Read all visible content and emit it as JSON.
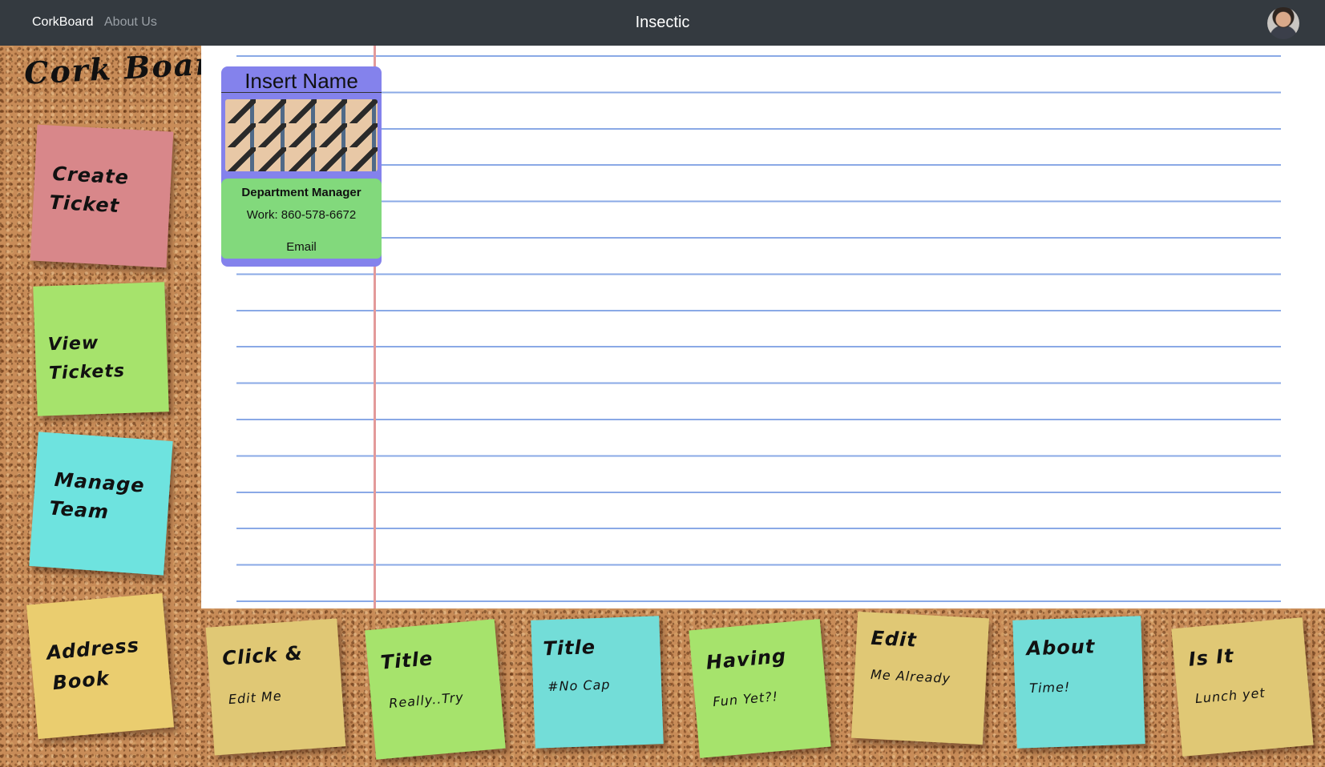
{
  "navbar": {
    "brand": "CorkBoard",
    "about": "About Us",
    "title": "Insectic",
    "avatar_icon": "user-avatar"
  },
  "sidebar": {
    "title": "Cork Board",
    "notes": [
      {
        "line1": "Create",
        "line2": "Ticket",
        "color": "#d8878a"
      },
      {
        "line1": "View Tickets",
        "line2": "",
        "color": "#a6e36c"
      },
      {
        "line1": "Manage",
        "line2": "Team",
        "color": "#6ee3df"
      },
      {
        "line1": "Address",
        "line2": "Book",
        "color": "#eacd6f"
      }
    ]
  },
  "card": {
    "name": "Insert Name",
    "role": "Department Manager",
    "phone": "Work: 860-578-6672",
    "email": "Email",
    "header_color": "#8482ec",
    "body_color": "#82d97c"
  },
  "bottom_notes": [
    {
      "title": "Click &",
      "body": "Edit Me",
      "color": "#e0c875"
    },
    {
      "title": "Title",
      "body": "Really..Try",
      "color": "#a6e36c"
    },
    {
      "title": "Title",
      "body": "#No Cap",
      "color": "#73ddd8"
    },
    {
      "title": "Having",
      "body": "Fun Yet?!",
      "color": "#a6e36c"
    },
    {
      "title": "Edit",
      "body": "Me Already",
      "color": "#e0c875"
    },
    {
      "title": "About",
      "body": "Time!",
      "color": "#73ddd8"
    },
    {
      "title": "Is It",
      "body": "Lunch yet",
      "color": "#e0c875"
    }
  ]
}
